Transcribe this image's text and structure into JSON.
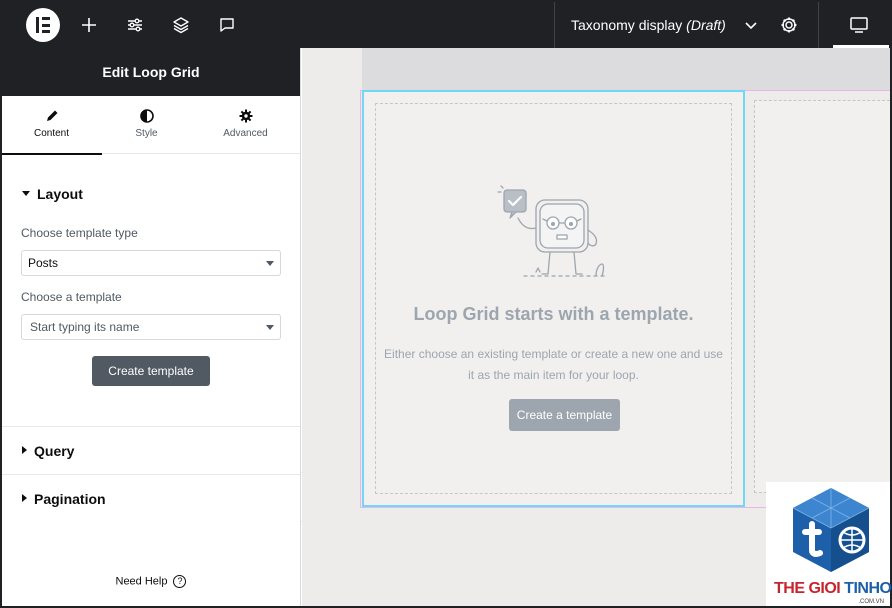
{
  "topbar": {
    "document_title": "Taxonomy display",
    "document_status": "(Draft)",
    "icons": [
      "elementor-logo-icon",
      "plus-icon",
      "sliders-icon",
      "layers-icon",
      "comment-icon",
      "chevron-down-icon",
      "gear-icon",
      "desktop-icon"
    ]
  },
  "panel": {
    "title": "Edit Loop Grid",
    "tabs": [
      {
        "label": "Content",
        "icon": "pencil-icon",
        "active": true
      },
      {
        "label": "Style",
        "icon": "half-circle-icon",
        "active": false
      },
      {
        "label": "Advanced",
        "icon": "gear-icon",
        "active": false
      }
    ],
    "layout": {
      "section_title": "Layout",
      "template_type_label": "Choose template type",
      "template_type_value": "Posts",
      "template_label": "Choose a template",
      "template_placeholder": "Start typing its name",
      "create_button": "Create template"
    },
    "query_title": "Query",
    "pagination_title": "Pagination",
    "need_help": "Need Help",
    "help_icon": "?"
  },
  "canvas": {
    "placeholder_title": "Loop Grid starts with a template.",
    "placeholder_desc_line1": "Either choose an existing template or create a new one and use",
    "placeholder_desc_line2": "it as the main item for your loop.",
    "create_button": "Create a template"
  },
  "watermark": {
    "text_red": "THE GIOI ",
    "text_blue": "TINHOC",
    "subtext": ".COM.VN"
  },
  "colors": {
    "topbar_bg": "#1f2124",
    "selected_item_border": "#71d7f7",
    "loop_area_border": "#e8b7e8",
    "placeholder_text": "#9da5ae"
  }
}
